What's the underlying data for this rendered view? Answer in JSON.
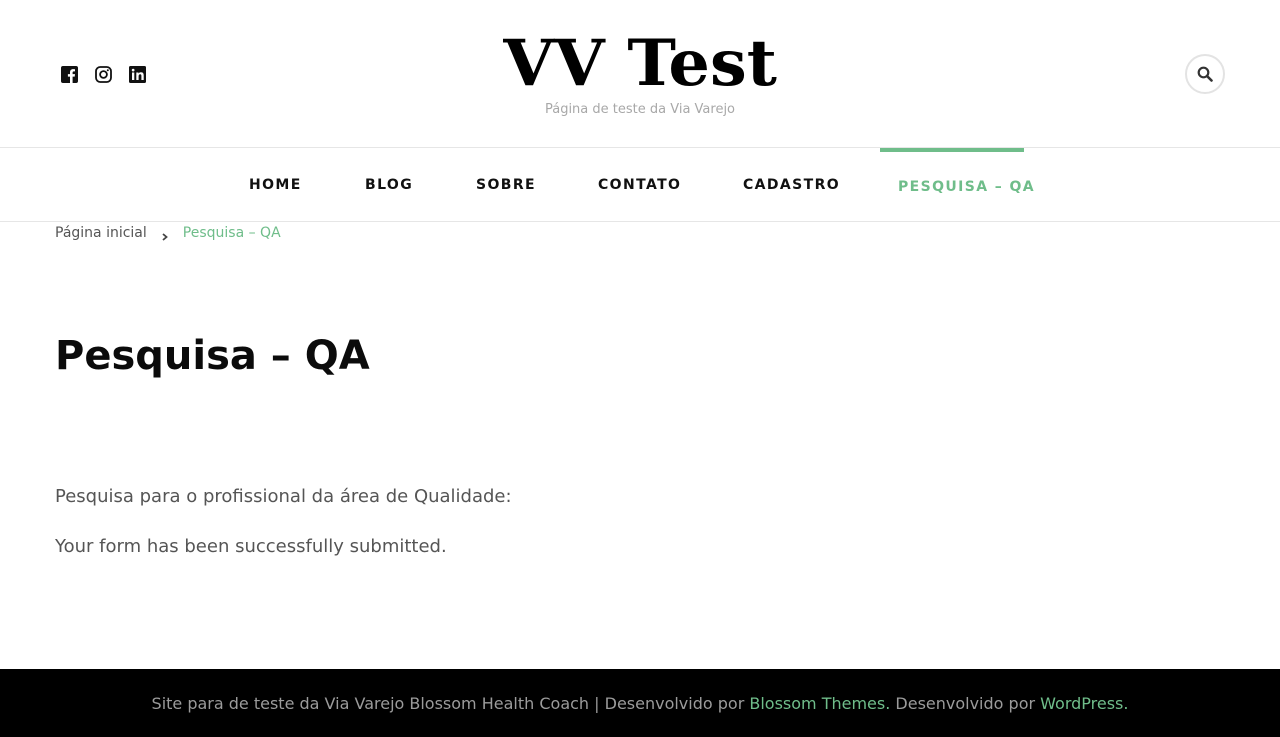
{
  "header": {
    "site_title": "VV Test",
    "site_description": "Página de teste da Via Varejo",
    "social_icons": [
      "facebook-icon",
      "instagram-icon",
      "linkedin-icon"
    ],
    "search_icon": "search-icon"
  },
  "nav": {
    "items": [
      {
        "label": "HOME"
      },
      {
        "label": "BLOG"
      },
      {
        "label": "SOBRE"
      },
      {
        "label": "CONTATO"
      },
      {
        "label": "CADASTRO"
      },
      {
        "label": "PESQUISA – QA",
        "active": true
      }
    ]
  },
  "breadcrumb": {
    "home": "Página inicial",
    "current": "Pesquisa – QA"
  },
  "main": {
    "title": "Pesquisa – QA",
    "paragraph_1": "Pesquisa para o profissional da área de Qualidade:",
    "paragraph_2": "Your form has been successfully submitted."
  },
  "footer": {
    "text_1": "Site para de teste da Via Varejo Blossom Health Coach | Desenvolvido por ",
    "link_1": "Blossom Themes.",
    "text_2": " Desenvolvido por ",
    "link_2": "WordPress."
  },
  "colors": {
    "accent": "#6fbd8a",
    "footer_bg": "#000000",
    "text": "#555555"
  }
}
